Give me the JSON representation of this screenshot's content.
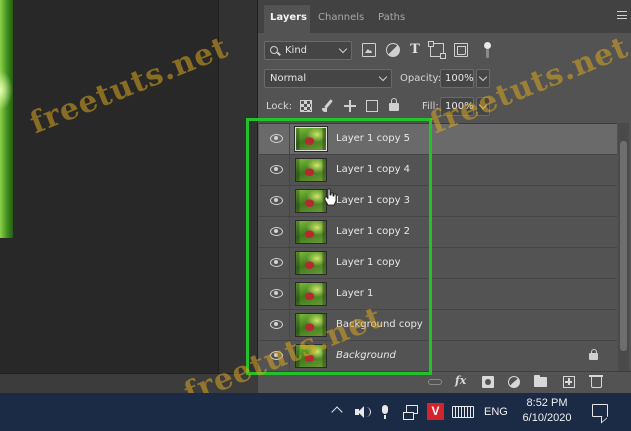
{
  "tabs": [
    {
      "label": "Layers",
      "active": true
    },
    {
      "label": "Channels",
      "active": false
    },
    {
      "label": "Paths",
      "active": false
    }
  ],
  "filter": {
    "kind_label": "Kind"
  },
  "blend": {
    "mode": "Normal",
    "opacity_label": "Opacity:",
    "opacity_value": "100%"
  },
  "lock": {
    "label": "Lock:",
    "fill_label": "Fill:",
    "fill_value": "100%"
  },
  "layers": [
    {
      "name": "Layer 1 copy 5",
      "visible": true,
      "selected": true,
      "italic": false
    },
    {
      "name": "Layer 1 copy 4",
      "visible": true,
      "selected": false,
      "italic": false
    },
    {
      "name": "Layer 1 copy 3",
      "visible": true,
      "selected": false,
      "italic": false
    },
    {
      "name": "Layer 1 copy 2",
      "visible": true,
      "selected": false,
      "italic": false
    },
    {
      "name": "Layer 1 copy",
      "visible": true,
      "selected": false,
      "italic": false
    },
    {
      "name": "Layer 1",
      "visible": true,
      "selected": false,
      "italic": false
    },
    {
      "name": "Background copy",
      "visible": true,
      "selected": false,
      "italic": false
    },
    {
      "name": "Background",
      "visible": true,
      "selected": false,
      "italic": true,
      "locked": true
    }
  ],
  "footer": {
    "fx_label": "fx"
  },
  "watermark": "freetuts.net",
  "taskbar": {
    "app_icon_letter": "V",
    "language": "ENG",
    "time": "8:52 PM",
    "date": "6/10/2020"
  },
  "colors": {
    "panel_bg": "#535353",
    "selected_row": "#6a6a6a",
    "highlight_border": "#22c22a",
    "taskbar_bg": "#1c2b45",
    "watermark": "#daa520"
  }
}
